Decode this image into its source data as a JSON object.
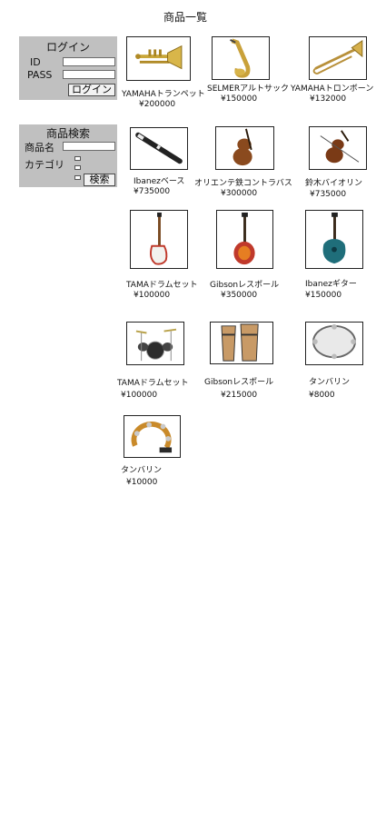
{
  "page": {
    "title": "商品一覧"
  },
  "login": {
    "heading": "ログイン",
    "id_label": "ID",
    "pass_label": "PASS",
    "id_value": "",
    "pass_value": "",
    "submit_label": "ログイン"
  },
  "search": {
    "heading": "商品検索",
    "name_label": "商品名",
    "category_label": "カテゴリ",
    "name_value": "",
    "submit_label": "検索"
  },
  "products": [
    {
      "name": "YAMAHAトランペット",
      "price": "¥200000",
      "icon": "trumpet-icon"
    },
    {
      "name": "SELMERアルトサック",
      "price": "¥150000",
      "icon": "saxophone-icon"
    },
    {
      "name": "YAMAHAトロンボーン",
      "price": "¥132000",
      "icon": "trombone-icon"
    },
    {
      "name": "Ibanezベース",
      "price": "¥735000",
      "icon": "recorder-icon"
    },
    {
      "name": "オリエンテ鉄コントラバス",
      "price": "¥300000",
      "icon": "contrabass-icon"
    },
    {
      "name": "鈴木バイオリン",
      "price": "¥735000",
      "icon": "violin-icon"
    },
    {
      "name": "TAMAドラムセット",
      "price": "¥100000",
      "icon": "bass-guitar-icon"
    },
    {
      "name": "Gibsonレスポール",
      "price": "¥350000",
      "icon": "electric-guitar-icon"
    },
    {
      "name": "Ibanezギター",
      "price": "¥150000",
      "icon": "acoustic-guitar-icon"
    },
    {
      "name": "TAMAドラムセット",
      "price": "¥100000",
      "icon": "drum-kit-icon"
    },
    {
      "name": "Gibsonレスポール",
      "price": "¥215000",
      "icon": "conga-drums-icon"
    },
    {
      "name": "タンバリン",
      "price": "¥8000",
      "icon": "tambourine-icon"
    },
    {
      "name": "タンバリン",
      "price": "¥10000",
      "icon": "tambourine-ring-icon"
    }
  ]
}
